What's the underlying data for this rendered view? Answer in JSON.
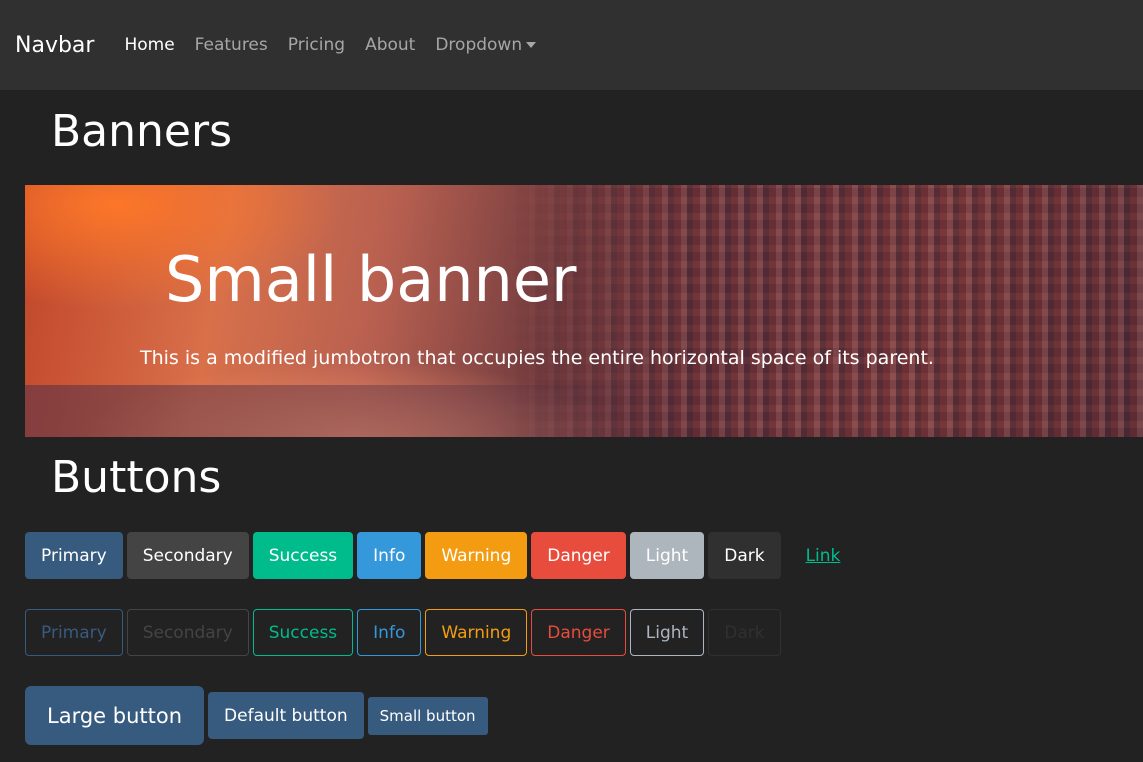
{
  "navbar": {
    "brand": "Navbar",
    "links": [
      {
        "label": "Home",
        "active": true
      },
      {
        "label": "Features"
      },
      {
        "label": "Pricing"
      },
      {
        "label": "About"
      },
      {
        "label": "Dropdown"
      }
    ]
  },
  "sections": {
    "banners_title": "Banners",
    "buttons_title": "Buttons"
  },
  "banner": {
    "title": "Small banner",
    "text": "This is a modified jumbotron that occupies the entire horizontal space of its parent."
  },
  "buttons": {
    "solid": [
      {
        "label": "Primary",
        "color": "#375a7f"
      },
      {
        "label": "Secondary",
        "color": "#444444"
      },
      {
        "label": "Success",
        "color": "#00bc8c"
      },
      {
        "label": "Info",
        "color": "#3498db"
      },
      {
        "label": "Warning",
        "color": "#f39c12"
      },
      {
        "label": "Danger",
        "color": "#e74c3c"
      },
      {
        "label": "Light",
        "color": "#adb5bd"
      },
      {
        "label": "Dark",
        "color": "#303030"
      },
      {
        "label": "Link",
        "color": "#00bc8c"
      }
    ],
    "outline": [
      {
        "label": "Primary",
        "color": "#375a7f"
      },
      {
        "label": "Secondary",
        "color": "#444444"
      },
      {
        "label": "Success",
        "color": "#00bc8c"
      },
      {
        "label": "Info",
        "color": "#3498db"
      },
      {
        "label": "Warning",
        "color": "#f39c12"
      },
      {
        "label": "Danger",
        "color": "#e74c3c"
      },
      {
        "label": "Light",
        "color": "#adb5bd"
      },
      {
        "label": "Dark",
        "color": "#303030"
      }
    ],
    "sizes": {
      "large": "Large button",
      "default": "Default button",
      "small": "Small button"
    }
  }
}
